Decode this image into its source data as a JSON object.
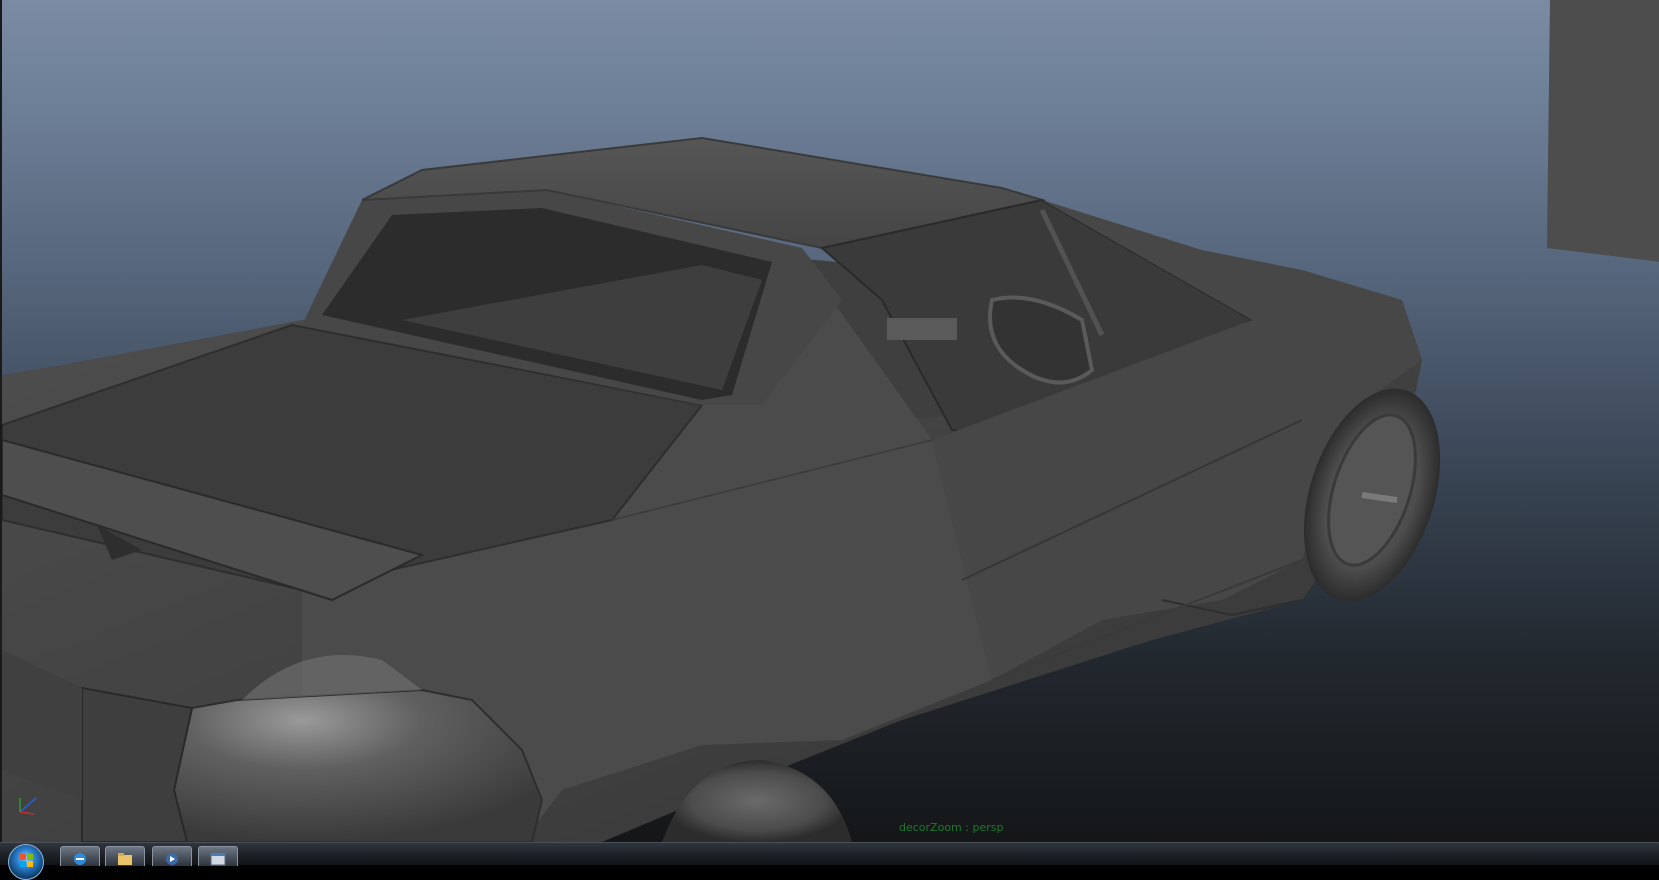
{
  "viewport": {
    "panel_label": "decorZoom : persp",
    "background_top": "#7b8ba4",
    "background_bottom": "#141618",
    "model_color": "#4a4a4a"
  },
  "taskbar": {
    "start_icon": "windows-start-orb",
    "buttons": [
      {
        "icon": "internet-explorer-icon"
      },
      {
        "icon": "folder-icon"
      },
      {
        "icon": "media-player-icon"
      },
      {
        "icon": "window-icon"
      }
    ]
  }
}
